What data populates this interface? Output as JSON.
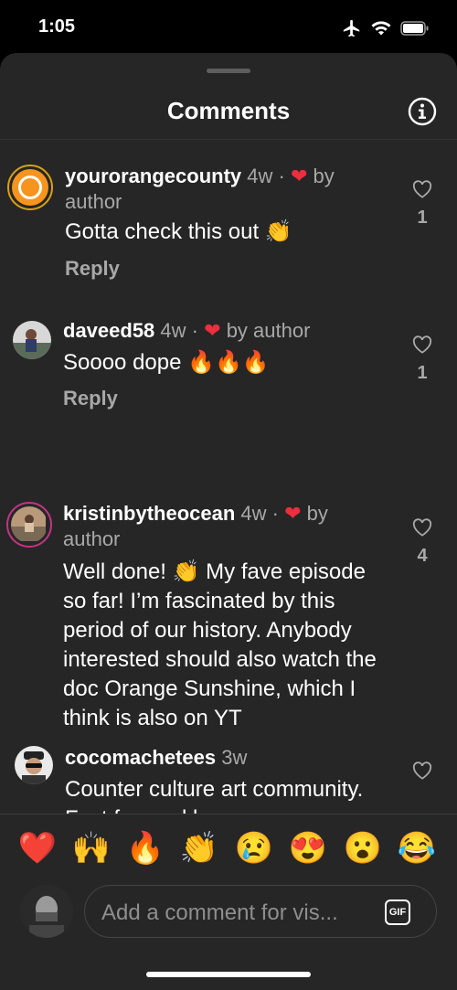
{
  "status_bar": {
    "time": "1:05"
  },
  "header": {
    "title": "Comments"
  },
  "comments": [
    {
      "username": "yourorangecounty",
      "age": "4w",
      "dot": "·",
      "heart": "❤",
      "liked_by": "by author",
      "text": "Gotta check this out 👏",
      "reply_label": "Reply",
      "like_count": "1",
      "avatar": "orange-circle-avatar"
    },
    {
      "username": "daveed58",
      "age": "4w",
      "dot": "·",
      "heart": "❤",
      "liked_by": "by author",
      "text": "Soooo dope 🔥🔥🔥",
      "reply_label": "Reply",
      "like_count": "1",
      "avatar": "photo-avatar"
    },
    {
      "username": "kristinbytheocean",
      "age": "4w",
      "dot": "·",
      "heart": "❤",
      "liked_by": "by author",
      "text": "Well done! 👏 My fave episode so far! I’m fascinated by this period of our history. Anybody interested should also watch the doc Orange Sunshine, which I think is also on YT",
      "like_count": "4",
      "avatar": "photo-avatar"
    },
    {
      "username": "cocomachetees",
      "age": "3w",
      "text": "Counter culture art community. Fast forward bans",
      "avatar": "photo-avatar"
    }
  ],
  "reactions": [
    "❤️",
    "🙌",
    "🔥",
    "👏",
    "😢",
    "😍",
    "😮",
    "😂"
  ],
  "composer": {
    "placeholder": "Add a comment for vis...",
    "gif_label": "GIF"
  },
  "colors": {
    "background": "#262626",
    "heart": "#ed2e3e",
    "muted_text": "#a8a8a8",
    "avatar_ring": "#c13584"
  }
}
